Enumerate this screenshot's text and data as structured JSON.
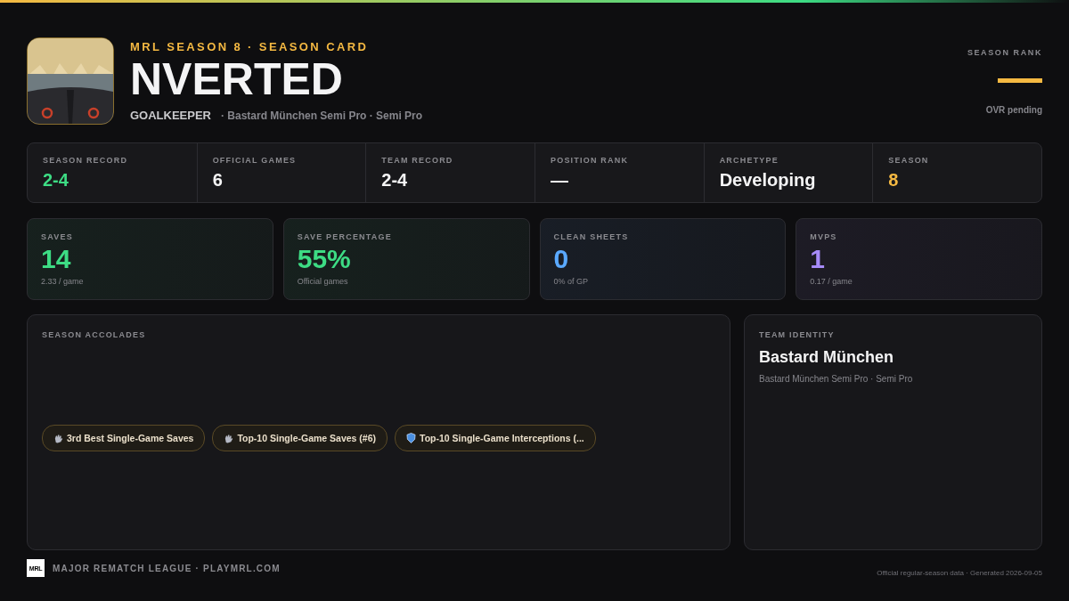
{
  "header": {
    "eyebrow": "MRL SEASON 8 · SEASON CARD",
    "player_name": "NVERTED",
    "position": "GOALKEEPER",
    "team_line": "· Bastard München Semi Pro · Semi Pro"
  },
  "season_rank": {
    "label": "SEASON RANK",
    "note": "OVR pending"
  },
  "summary": [
    {
      "label": "SEASON RECORD",
      "value": "2-4",
      "color": "#3ddc84"
    },
    {
      "label": "OFFICIAL GAMES",
      "value": "6",
      "color": "#f4f4f5"
    },
    {
      "label": "TEAM RECORD",
      "value": "2-4",
      "color": "#f4f4f5"
    },
    {
      "label": "POSITION RANK",
      "value": "—",
      "color": "#f4f4f5"
    },
    {
      "label": "ARCHETYPE",
      "value": "Developing",
      "color": "#f4f4f5"
    },
    {
      "label": "SEASON",
      "value": "8",
      "color": "#f5b942"
    }
  ],
  "stat_cards": [
    {
      "label": "SAVES",
      "value": "14",
      "sub": "2.33 / game",
      "color": "#3ddc84"
    },
    {
      "label": "SAVE PERCENTAGE",
      "value": "55%",
      "sub": "Official games",
      "color": "#3ddc84"
    },
    {
      "label": "CLEAN SHEETS",
      "value": "0",
      "sub": "0% of GP",
      "color": "#5aa9ff"
    },
    {
      "label": "MVPS",
      "value": "1",
      "sub": "0.17 / game",
      "color": "#a78bfa"
    }
  ],
  "accolades": {
    "title": "SEASON ACCOLADES",
    "items": [
      {
        "kind": "glove",
        "label": "3rd Best Single-Game Saves"
      },
      {
        "kind": "glove",
        "label": "Top-10 Single-Game Saves (#6)"
      },
      {
        "kind": "shield",
        "label": "Top-10 Single-Game Interceptions (..."
      }
    ]
  },
  "team_identity": {
    "title": "TEAM IDENTITY",
    "name": "Bastard München",
    "sub": "Bastard München Semi Pro · Semi Pro"
  },
  "footer": {
    "logo": "MRL",
    "left": "MAJOR REMATCH LEAGUE · PLAYMRL.COM",
    "right": "Official regular-season data · Generated 2026-09-05"
  }
}
